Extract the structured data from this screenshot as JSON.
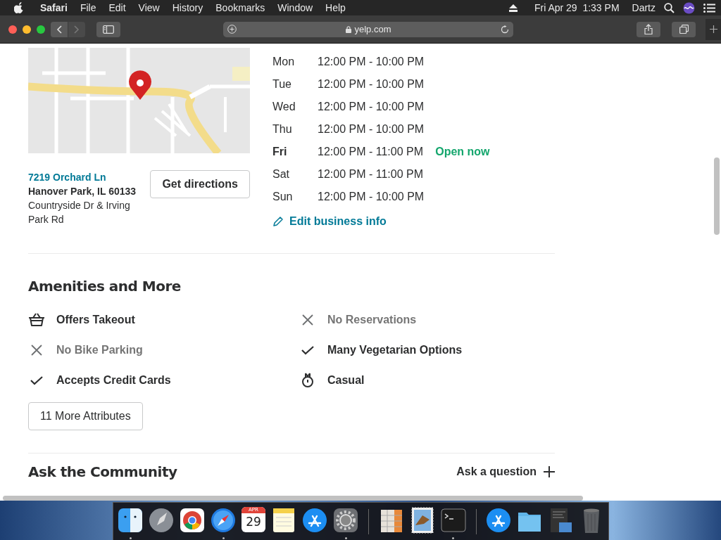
{
  "menu_bar": {
    "app": "Safari",
    "items": [
      "File",
      "Edit",
      "View",
      "History",
      "Bookmarks",
      "Window",
      "Help"
    ],
    "clock": "Fri Apr 29  1:33 PM",
    "user": "Dartz"
  },
  "toolbar": {
    "address": "yelp.com"
  },
  "location": {
    "street": "7219 Orchard Ln",
    "city": "Hanover Park, IL 60133",
    "cross_streets": "Countryside Dr & Irving Park Rd",
    "directions_button": "Get directions"
  },
  "hours": [
    {
      "day": "Mon",
      "time": "12:00 PM - 10:00 PM",
      "selected": false
    },
    {
      "day": "Tue",
      "time": "12:00 PM - 10:00 PM",
      "selected": false
    },
    {
      "day": "Wed",
      "time": "12:00 PM - 10:00 PM",
      "selected": false
    },
    {
      "day": "Thu",
      "time": "12:00 PM - 10:00 PM",
      "selected": false
    },
    {
      "day": "Fri",
      "time": "12:00 PM - 11:00 PM",
      "selected": true,
      "status": "Open now"
    },
    {
      "day": "Sat",
      "time": "12:00 PM - 11:00 PM",
      "selected": false
    },
    {
      "day": "Sun",
      "time": "12:00 PM - 10:00 PM",
      "selected": false
    }
  ],
  "edit_link": "Edit business info",
  "amenities": {
    "title": "Amenities and More",
    "items": [
      {
        "label": "Offers Takeout",
        "kind": "takeout",
        "available": true
      },
      {
        "label": "No Reservations",
        "kind": "cross",
        "available": false
      },
      {
        "label": "No Bike Parking",
        "kind": "cross",
        "available": false
      },
      {
        "label": "Many Vegetarian Options",
        "kind": "check",
        "available": true
      },
      {
        "label": "Accepts Credit Cards",
        "kind": "check",
        "available": true
      },
      {
        "label": "Casual",
        "kind": "casual",
        "available": true
      }
    ],
    "more_button": "11 More Attributes"
  },
  "community": {
    "title": "Ask the Community",
    "ask_button": "Ask a question"
  },
  "dock": [
    {
      "kind": "finder",
      "running": true
    },
    {
      "kind": "launchpad",
      "running": false
    },
    {
      "kind": "chrome",
      "running": false
    },
    {
      "kind": "safari",
      "running": true
    },
    {
      "kind": "calendar",
      "running": false,
      "month": "APR",
      "day": "29"
    },
    {
      "kind": "notes",
      "running": false
    },
    {
      "kind": "appstore",
      "running": false
    },
    {
      "kind": "settings",
      "running": true
    },
    {
      "kind": "separator"
    },
    {
      "kind": "spreadsheet",
      "running": false
    },
    {
      "kind": "stamp",
      "running": false
    },
    {
      "kind": "terminal",
      "running": true
    },
    {
      "kind": "separator"
    },
    {
      "kind": "appstore",
      "running": false
    },
    {
      "kind": "folder",
      "running": false
    },
    {
      "kind": "document",
      "running": false
    },
    {
      "kind": "trash",
      "running": false
    }
  ]
}
